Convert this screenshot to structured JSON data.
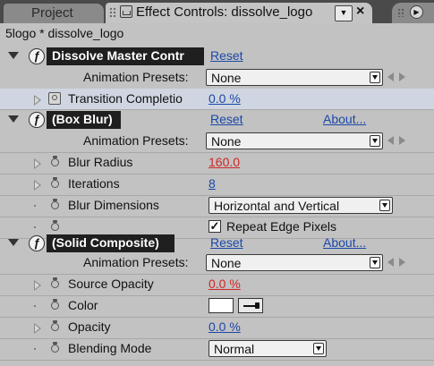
{
  "tabs": {
    "project_label": "Project",
    "effect_controls_label": "Effect Controls: dissolve_logo",
    "menu_glyph": "▼",
    "close_glyph": "×",
    "forward_glyph": "▶"
  },
  "composition_title": "5logo * dissolve_logo",
  "effects": [
    {
      "name": "Dissolve Master Contr",
      "reset": "Reset",
      "presets_label": "Animation Presets:",
      "preset_value": "None",
      "properties": [
        {
          "label": "Transition Completio",
          "value": "0.0 %"
        }
      ]
    },
    {
      "name": "(Box Blur)",
      "reset": "Reset",
      "about": "About...",
      "presets_label": "Animation Presets:",
      "preset_value": "None",
      "properties": [
        {
          "label": "Blur Radius",
          "value": "160.0"
        },
        {
          "label": "Iterations",
          "value": "8"
        },
        {
          "label": "Blur Dimensions",
          "value": "Horizontal and Vertical"
        },
        {
          "label": "",
          "value": "Repeat Edge Pixels",
          "checked": true
        }
      ]
    },
    {
      "name": "(Solid Composite)",
      "reset": "Reset",
      "about": "About...",
      "presets_label": "Animation Presets:",
      "preset_value": "None",
      "properties": [
        {
          "label": "Source Opacity",
          "value": "0.0 %"
        },
        {
          "label": "Color",
          "value": "#ffffff"
        },
        {
          "label": "Opacity",
          "value": "0.0 %"
        },
        {
          "label": "Blending Mode",
          "value": "Normal"
        }
      ]
    }
  ],
  "glyphs": {
    "fx": "ƒ",
    "check": "✓"
  },
  "colors": {
    "value_blue": "#1b48a8",
    "value_red": "#d02626",
    "highlight_row": "#cfd6e1"
  }
}
